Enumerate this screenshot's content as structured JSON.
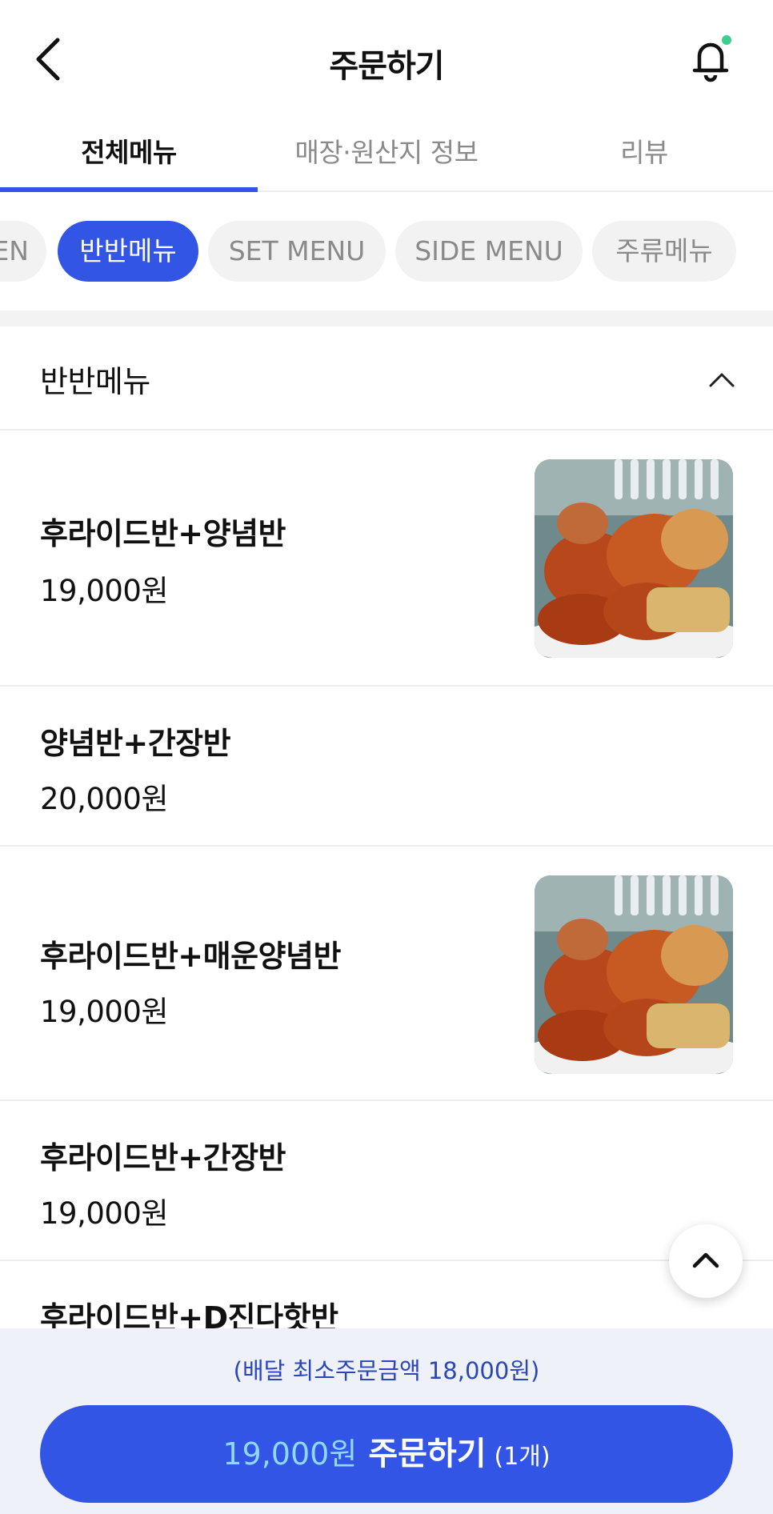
{
  "header": {
    "title": "주문하기",
    "back_icon": "chevron-left-icon",
    "bell_icon": "bell-icon",
    "notification_dot_color": "#3ecf8e"
  },
  "tabs": [
    {
      "label": "전체메뉴",
      "active": true
    },
    {
      "label": "매장·원산지 정보",
      "active": false
    },
    {
      "label": "리뷰",
      "active": false
    }
  ],
  "categories": [
    {
      "label": "EN",
      "active": false
    },
    {
      "label": "반반메뉴",
      "active": true
    },
    {
      "label": "SET MENU",
      "active": false
    },
    {
      "label": "SIDE MENU",
      "active": false
    },
    {
      "label": "주류메뉴",
      "active": false
    }
  ],
  "section": {
    "title": "반반메뉴",
    "collapse_icon": "chevron-up-icon"
  },
  "menu_items": [
    {
      "name": "후라이드반+양념반",
      "price": "19,000원",
      "has_image": true
    },
    {
      "name": "양념반+간장반",
      "price": "20,000원",
      "has_image": false
    },
    {
      "name": "후라이드반+매운양념반",
      "price": "19,000원",
      "has_image": true
    },
    {
      "name": "후라이드반+간장반",
      "price": "19,000원",
      "has_image": false
    },
    {
      "name": "후라이드반+D진다핫반",
      "price": "",
      "has_image": false
    }
  ],
  "scroll_top_icon": "chevron-up-icon",
  "bottom_bar": {
    "min_order_text": "(배달 최소주문금액 18,000원)",
    "order_price": "19,000원",
    "order_label": "주문하기",
    "order_count": "(1개)"
  },
  "colors": {
    "accent": "#3355e6",
    "price_highlight": "#8fd8ff",
    "bottom_bar_bg": "#eef1f8"
  }
}
